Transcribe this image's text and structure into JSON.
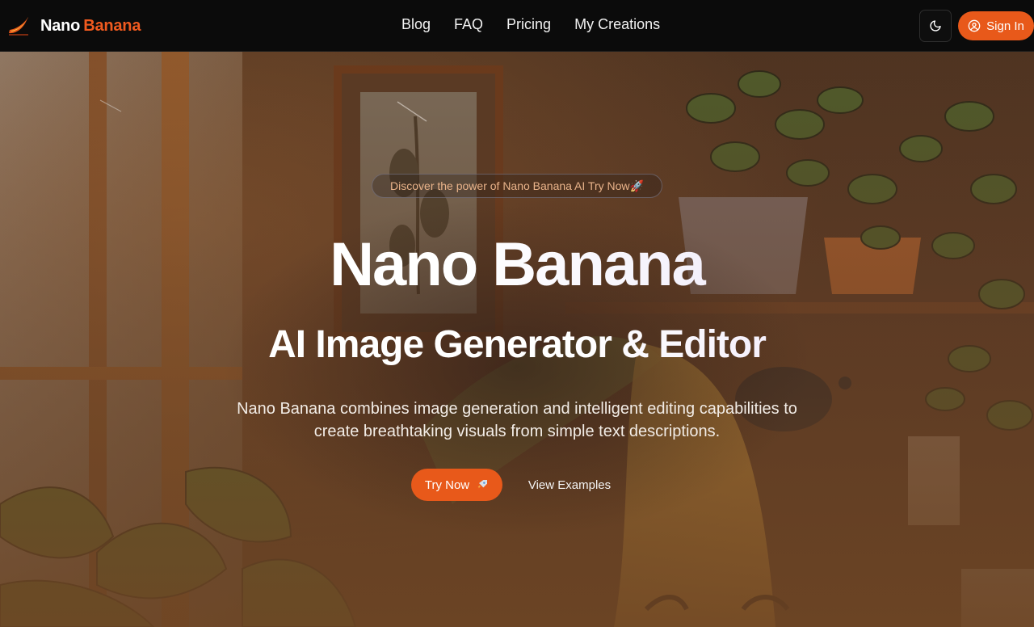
{
  "header": {
    "logo": {
      "word1": "Nano",
      "word2": "Banana"
    },
    "nav": [
      {
        "label": "Blog"
      },
      {
        "label": "FAQ"
      },
      {
        "label": "Pricing"
      },
      {
        "label": "My Creations"
      }
    ],
    "theme_toggle_icon": "moon-icon",
    "signin": {
      "label": "Sign In",
      "icon": "user-circle-icon"
    }
  },
  "hero": {
    "badge": "Discover the power of Nano Banana AI Try Now🚀",
    "title": "Nano Banana",
    "subtitle": "AI Image Generator & Editor",
    "description": "Nano Banana combines image generation and intelligent editing capabilities to create breathtaking visuals from simple text descriptions.",
    "primary_cta": {
      "label": "Try Now",
      "icon": "rocket-icon"
    },
    "secondary_cta": {
      "label": "View Examples"
    }
  },
  "colors": {
    "accent": "#e8591a",
    "header_bg": "#0b0b0b",
    "badge_text": "#e9b38a"
  }
}
